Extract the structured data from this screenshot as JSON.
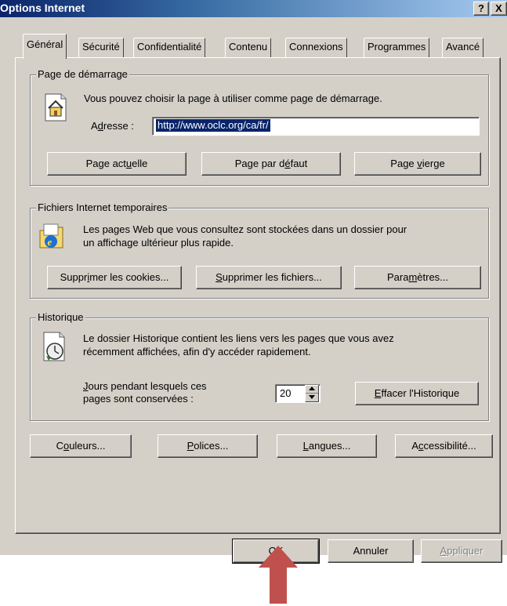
{
  "window": {
    "title": "Options Internet",
    "help_label": "?",
    "close_label": "X"
  },
  "tabs": [
    {
      "label": "Général",
      "active": true
    },
    {
      "label": "Sécurité"
    },
    {
      "label": "Confidentialité"
    },
    {
      "label": "Contenu"
    },
    {
      "label": "Connexions"
    },
    {
      "label": "Programmes"
    },
    {
      "label": "Avancé"
    }
  ],
  "homepage": {
    "legend": "Page de démarrage",
    "description": "Vous pouvez choisir la page à utiliser comme page de démarrage.",
    "address_label_pre": "A",
    "address_label_accel": "d",
    "address_label_post": "resse :",
    "address_value": "http://www.oclc.org/ca/fr/",
    "btn_current_pre": "Page act",
    "btn_current_accel": "u",
    "btn_current_post": "elle",
    "btn_default_pre": "Page par d",
    "btn_default_accel": "é",
    "btn_default_post": "faut",
    "btn_blank_pre": "Page ",
    "btn_blank_accel": "v",
    "btn_blank_post": "ierge"
  },
  "temp_files": {
    "legend": "Fichiers Internet temporaires",
    "line1": "Les pages Web que vous consultez sont stockées dans un dossier pour",
    "line2": "un affichage ultérieur plus rapide.",
    "btn_cookies_pre": "Suppr",
    "btn_cookies_accel": "i",
    "btn_cookies_post": "mer les cookies...",
    "btn_files_pre": "",
    "btn_files_accel": "S",
    "btn_files_post": "upprimer les fichiers...",
    "btn_settings_pre": "Para",
    "btn_settings_accel": "m",
    "btn_settings_post": "ètres..."
  },
  "history": {
    "legend": "Historique",
    "line1": "Le dossier Historique contient les liens vers les pages que vous avez",
    "line2": "récemment affichées, afin d'y accéder rapidement.",
    "days_line1_pre": "",
    "days_line1_accel": "J",
    "days_line1_post": "ours pendant lesquels ces",
    "days_line2": "pages sont conservées :",
    "days_value": "20",
    "btn_clear_pre": "",
    "btn_clear_accel": "E",
    "btn_clear_post": "ffacer l'Historique"
  },
  "bottom_buttons": {
    "colors_pre": "C",
    "colors_accel": "o",
    "colors_post": "uleurs...",
    "fonts_pre": "",
    "fonts_accel": "P",
    "fonts_post": "olices...",
    "languages_pre": "",
    "languages_accel": "L",
    "languages_post": "angues...",
    "accessibility_pre": "A",
    "accessibility_accel": "c",
    "accessibility_post": "cessibilité..."
  },
  "dialog_buttons": {
    "ok": "OK",
    "cancel": "Annuler",
    "apply_pre": "",
    "apply_accel": "A",
    "apply_post": "ppliquer"
  },
  "colors": {
    "titlebar_start": "#0a246a",
    "titlebar_end": "#a6caf0",
    "face": "#d4d0c8",
    "annotation_arrow": "#c0504d"
  }
}
